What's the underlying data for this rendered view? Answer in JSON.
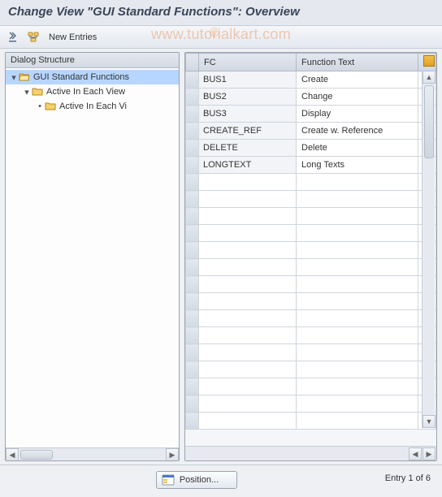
{
  "title": "Change View \"GUI Standard Functions\": Overview",
  "toolbar": {
    "new_entries_label": "New Entries"
  },
  "watermark": "www.tutorialkart.com",
  "tree": {
    "header": "Dialog Structure",
    "nodes": [
      {
        "label": "GUI Standard Functions",
        "indent": 0,
        "open": true,
        "selected": true,
        "icon": "folder-open"
      },
      {
        "label": "Active In Each View",
        "indent": 1,
        "open": true,
        "selected": false,
        "icon": "folder"
      },
      {
        "label": "Active In Each Vi",
        "indent": 2,
        "open": false,
        "selected": false,
        "icon": "folder"
      }
    ]
  },
  "table": {
    "columns": [
      "FC",
      "Function Text"
    ],
    "rows": [
      {
        "fc": "BUS1",
        "ft": "Create"
      },
      {
        "fc": "BUS2",
        "ft": "Change"
      },
      {
        "fc": "BUS3",
        "ft": "Display"
      },
      {
        "fc": "CREATE_REF",
        "ft": "Create w. Reference"
      },
      {
        "fc": "DELETE",
        "ft": "Delete"
      },
      {
        "fc": "LONGTEXT",
        "ft": "Long Texts"
      }
    ],
    "empty_rows": 15
  },
  "footer": {
    "position_label": "Position...",
    "entry_info": "Entry 1 of 6"
  }
}
